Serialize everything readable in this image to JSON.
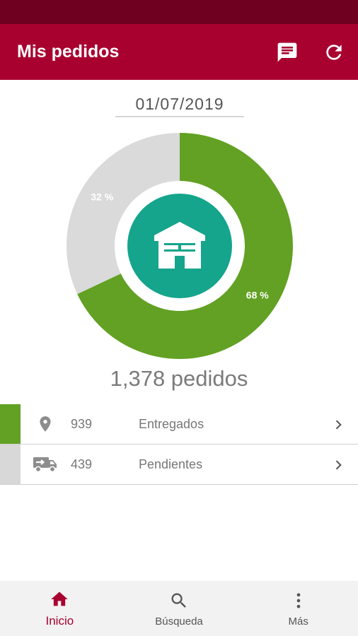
{
  "app_bar": {
    "title": "Mis pedidos",
    "actions": [
      {
        "icon": "message-icon"
      },
      {
        "icon": "refresh-icon"
      }
    ]
  },
  "date": "01/07/2019",
  "chart_data": {
    "type": "pie",
    "categories": [
      "Entregados",
      "Pendientes"
    ],
    "values": [
      68,
      32
    ],
    "labels": [
      "68 %",
      "32 %"
    ],
    "colors": [
      "#62a123",
      "#dadada"
    ],
    "center_icon": "warehouse-icon",
    "center_color": "#14a58c"
  },
  "total": "1,378 pedidos",
  "rows": [
    {
      "icon": "location-pin-icon",
      "count": "939",
      "label": "Entregados",
      "color": "#62a123"
    },
    {
      "icon": "delivery-truck-icon",
      "count": "439",
      "label": "Pendientes",
      "color": "#d8d8d8"
    }
  ],
  "bottom_nav": [
    {
      "icon": "home-icon",
      "label": "Inicio",
      "active": true
    },
    {
      "icon": "search-icon",
      "label": "Búsqueda",
      "active": false
    },
    {
      "icon": "more-vert-icon",
      "label": "Más",
      "active": false
    }
  ],
  "colors": {
    "primary": "#a8002f",
    "primary_dark": "#6f0020",
    "accent": "#14a58c"
  }
}
